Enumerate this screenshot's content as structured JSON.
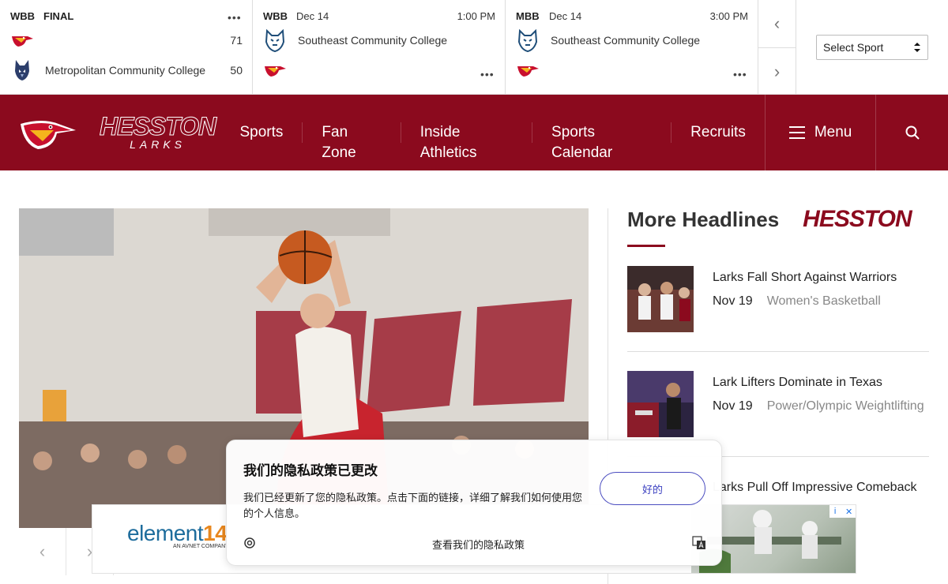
{
  "scoreboard": {
    "games": [
      {
        "sport": "WBB",
        "status": "FINAL",
        "date": "",
        "time": "",
        "team1": {
          "name": "",
          "score": "71",
          "logo": "lark-logo"
        },
        "team2": {
          "name": "Metropolitan Community College",
          "score": "50",
          "logo": "wolf-logo"
        },
        "more": "•••"
      },
      {
        "sport": "WBB",
        "status": "",
        "date": "Dec 14",
        "time": "1:00 PM",
        "team1": {
          "name": "Southeast Community College",
          "score": "",
          "logo": "bobcat-logo"
        },
        "team2": {
          "name": "",
          "score": "",
          "logo": "lark-logo"
        },
        "more": "•••"
      },
      {
        "sport": "MBB",
        "status": "",
        "date": "Dec 14",
        "time": "3:00 PM",
        "team1": {
          "name": "Southeast Community College",
          "score": "",
          "logo": "bobcat-logo"
        },
        "team2": {
          "name": "",
          "score": "",
          "logo": "lark-logo"
        },
        "more": "•••"
      }
    ],
    "prev_icon": "‹",
    "next_icon": "›",
    "select_sport": "Select Sport"
  },
  "header": {
    "wordmark": "HESSTON",
    "wordmark_sub": "LARKS",
    "nav": [
      "Sports",
      "Fan Zone",
      "Inside Athletics",
      "Sports Calendar",
      "Recruits"
    ],
    "menu_label": "Menu",
    "brand_color": "#8b0a1e"
  },
  "hero": {
    "prev_icon": "‹",
    "next_icon": "›"
  },
  "headlines": {
    "title": "More Headlines",
    "logo_text": "HESSTON",
    "stories": [
      {
        "title": "Larks Fall Short Against Warriors",
        "date": "Nov 19",
        "category": "Women's Basketball"
      },
      {
        "title": "Lark Lifters Dominate in Texas",
        "date": "Nov 19",
        "category": "Power/Olympic Weightlifting"
      },
      {
        "title": "Larks Pull Off Impressive Comeback",
        "date": "",
        "category": ""
      }
    ]
  },
  "privacy": {
    "title": "我们的隐私政策已更改",
    "body": "我们已经更新了您的隐私政策。点击下面的链接，详细了解我们如何使用您的个人信息。",
    "ok_button": "好的",
    "link": "查看我们的隐私政策"
  },
  "ad": {
    "brand_a": "element",
    "brand_b": "14",
    "sub": "AN AVNET COMPANY",
    "info": "i",
    "close": "✕"
  }
}
